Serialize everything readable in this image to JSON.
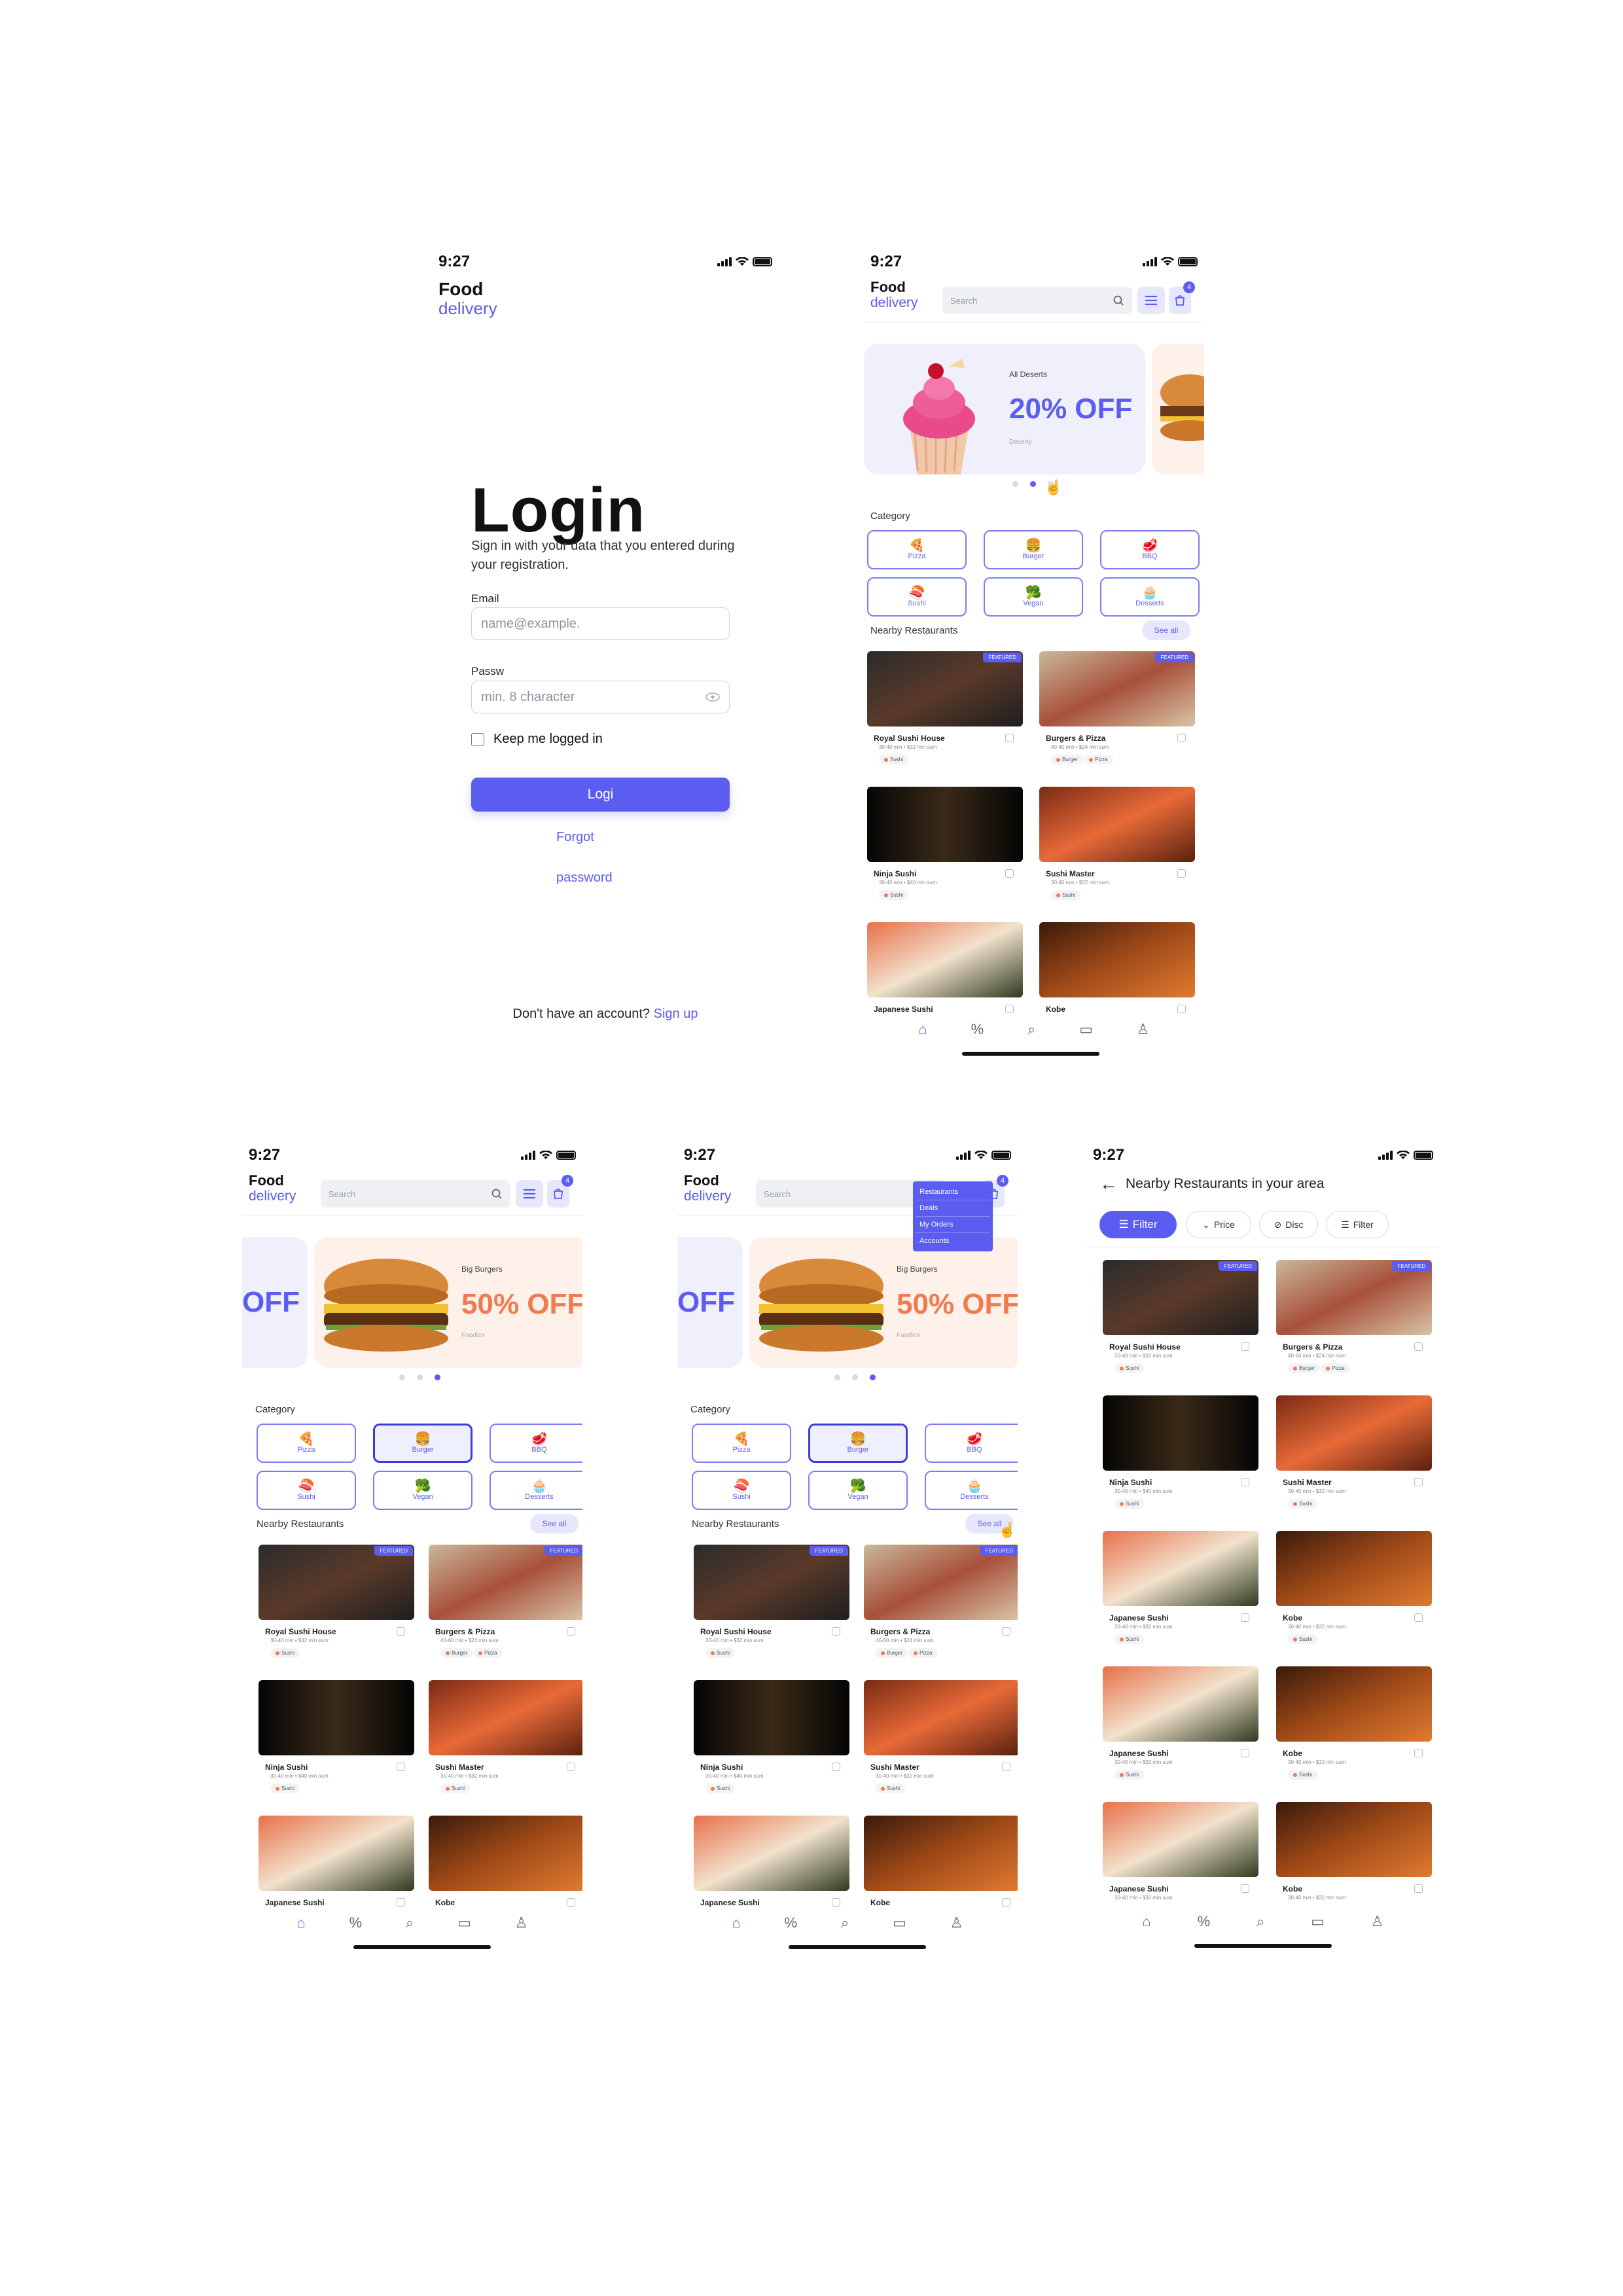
{
  "status_time": "9:27",
  "brand": {
    "line1": "Food",
    "line2": "delivery"
  },
  "login": {
    "title": "Login",
    "subtitle": "Sign in with your data that you entered during your registration.",
    "email_label": "Email",
    "email_placeholder": "name@example.",
    "password_label": "Passw",
    "password_placeholder": "min. 8 character",
    "keep_logged": "Keep me logged in",
    "button": "Logi",
    "forgot_1": "Forgot",
    "forgot_2": "password",
    "no_account": "Don't have an account?",
    "signup": "Sign up"
  },
  "home": {
    "search_placeholder": "Search",
    "cart_count": "4",
    "banner_desserts": {
      "small": "All Deserts",
      "big": "20% OFF",
      "foot": "Deserty"
    },
    "banner_burgers": {
      "small": "Big Burgers",
      "big": "50% OFF",
      "foot": "Foodies"
    },
    "banner_left_fragment": "OFF",
    "category_label": "Category",
    "categories": [
      {
        "label": "Pizza",
        "icon": "pizza-icon",
        "glyph": "🍕"
      },
      {
        "label": "Burger",
        "icon": "burger-icon",
        "glyph": "🍔"
      },
      {
        "label": "BBQ",
        "icon": "steak-icon",
        "glyph": "🥩"
      },
      {
        "label": "Sushi",
        "icon": "sushi-icon",
        "glyph": "🍣"
      },
      {
        "label": "Vegan",
        "icon": "broccoli-icon",
        "glyph": "🥦"
      },
      {
        "label": "Desserts",
        "icon": "cupcake-icon",
        "glyph": "🧁"
      }
    ],
    "nearby_label": "Nearby Restaurants",
    "see_all": "See all",
    "featured": "FEATURED",
    "restaurants": [
      {
        "name": "Royal Sushi House",
        "meta": "30-40 min • $32 min sum",
        "tags": [
          "Sushi"
        ],
        "featured": true
      },
      {
        "name": "Burgers & Pizza",
        "meta": "40-60 min • $24 min sum",
        "tags": [
          "Burger",
          "Pizza"
        ],
        "featured": true
      },
      {
        "name": "Ninja Sushi",
        "meta": "30-40 min • $40 min sum",
        "tags": [
          "Sushi"
        ],
        "featured": false
      },
      {
        "name": "Sushi Master",
        "meta": "30-40 min • $32 min sum",
        "tags": [
          "Sushi"
        ],
        "featured": false
      },
      {
        "name": "Japanese Sushi",
        "meta": "30-40 min • $32 min sum",
        "tags": [
          "Sushi"
        ],
        "featured": false
      },
      {
        "name": "Kobe",
        "meta": "30-40 min • $32 min sum",
        "tags": [
          "Sushi"
        ],
        "featured": false
      }
    ],
    "menu": [
      "Restaurants",
      "Deals",
      "My Orders",
      "Accounts"
    ]
  },
  "list": {
    "title": "Nearby Restaurants in your area",
    "chips": [
      "Filter",
      "Price",
      "Disc",
      "Filter"
    ]
  },
  "colors": {
    "accent": "#5b5cf0",
    "accent_light": "#e6e7fd",
    "orange": "#f07b4e"
  }
}
